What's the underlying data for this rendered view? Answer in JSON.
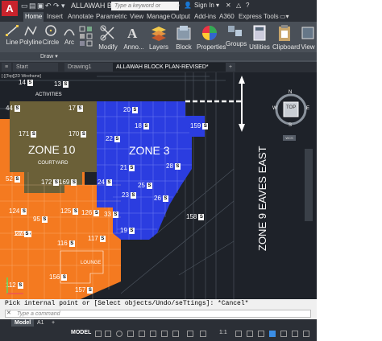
{
  "app": {
    "logo": "A",
    "title": "ALLAWAH BL...",
    "search_placeholder": "Type a keyword or phrase",
    "sign_in": "Sign In",
    "help": "?"
  },
  "menu_tabs": [
    "Home",
    "Insert",
    "Annotate",
    "Parametric",
    "View",
    "Manage",
    "Output",
    "Add-ins",
    "A360",
    "Express Tools"
  ],
  "ribbon": {
    "line": "Line",
    "polyline": "Polyline",
    "circle": "Circle",
    "arc": "Arc",
    "modify": "Modify",
    "annotation": "Anno...",
    "layers": "Layers",
    "block": "Block",
    "properties": "Properties",
    "groups": "Groups",
    "utilities": "Utilities",
    "clipboard": "Clipboard",
    "view": "View",
    "draw_panel": "Draw"
  },
  "doc_tabs": [
    "Start",
    "Drawing1",
    "ALLAWAH BLOCK PLAN-REVISED*"
  ],
  "viewport_label": "[-][Top][2D Wireframe]",
  "viewcube": {
    "top": "TOP",
    "n": "N",
    "s": "S",
    "e": "E",
    "w": "W",
    "wcs": "WCS"
  },
  "plan": {
    "zone10": "ZONE 10",
    "zone3": "ZONE 3",
    "zone9": "ZONE 9 EAVES EAST",
    "courtyard": "COURTYARD",
    "activities": "ACTIVITIES",
    "lounge": "LOUNGE",
    "rooms": [
      "14",
      "13",
      "17",
      "44",
      "20",
      "18",
      "22",
      "159",
      "171",
      "170",
      "21",
      "28",
      "52",
      "172",
      "169",
      "24",
      "23",
      "26",
      "125",
      "126",
      "33",
      "158",
      "95",
      "27",
      "19",
      "122",
      "116",
      "117",
      "22",
      "156",
      "157",
      "112",
      "124",
      "25"
    ]
  },
  "command": {
    "prompt": "Pick internal point or [Select objects/Undo/seTtings]: *Cancel*",
    "input_placeholder": "Type a command"
  },
  "layout_tabs": [
    "Model",
    "A1",
    "+"
  ],
  "status": {
    "model": "MODEL",
    "scale": "1:1"
  },
  "colors": {
    "orange": "#f47a20",
    "blue": "#2b3de0",
    "olive": "#6b6038",
    "canvas": "#1e2229",
    "ribbon": "#4a5058"
  }
}
